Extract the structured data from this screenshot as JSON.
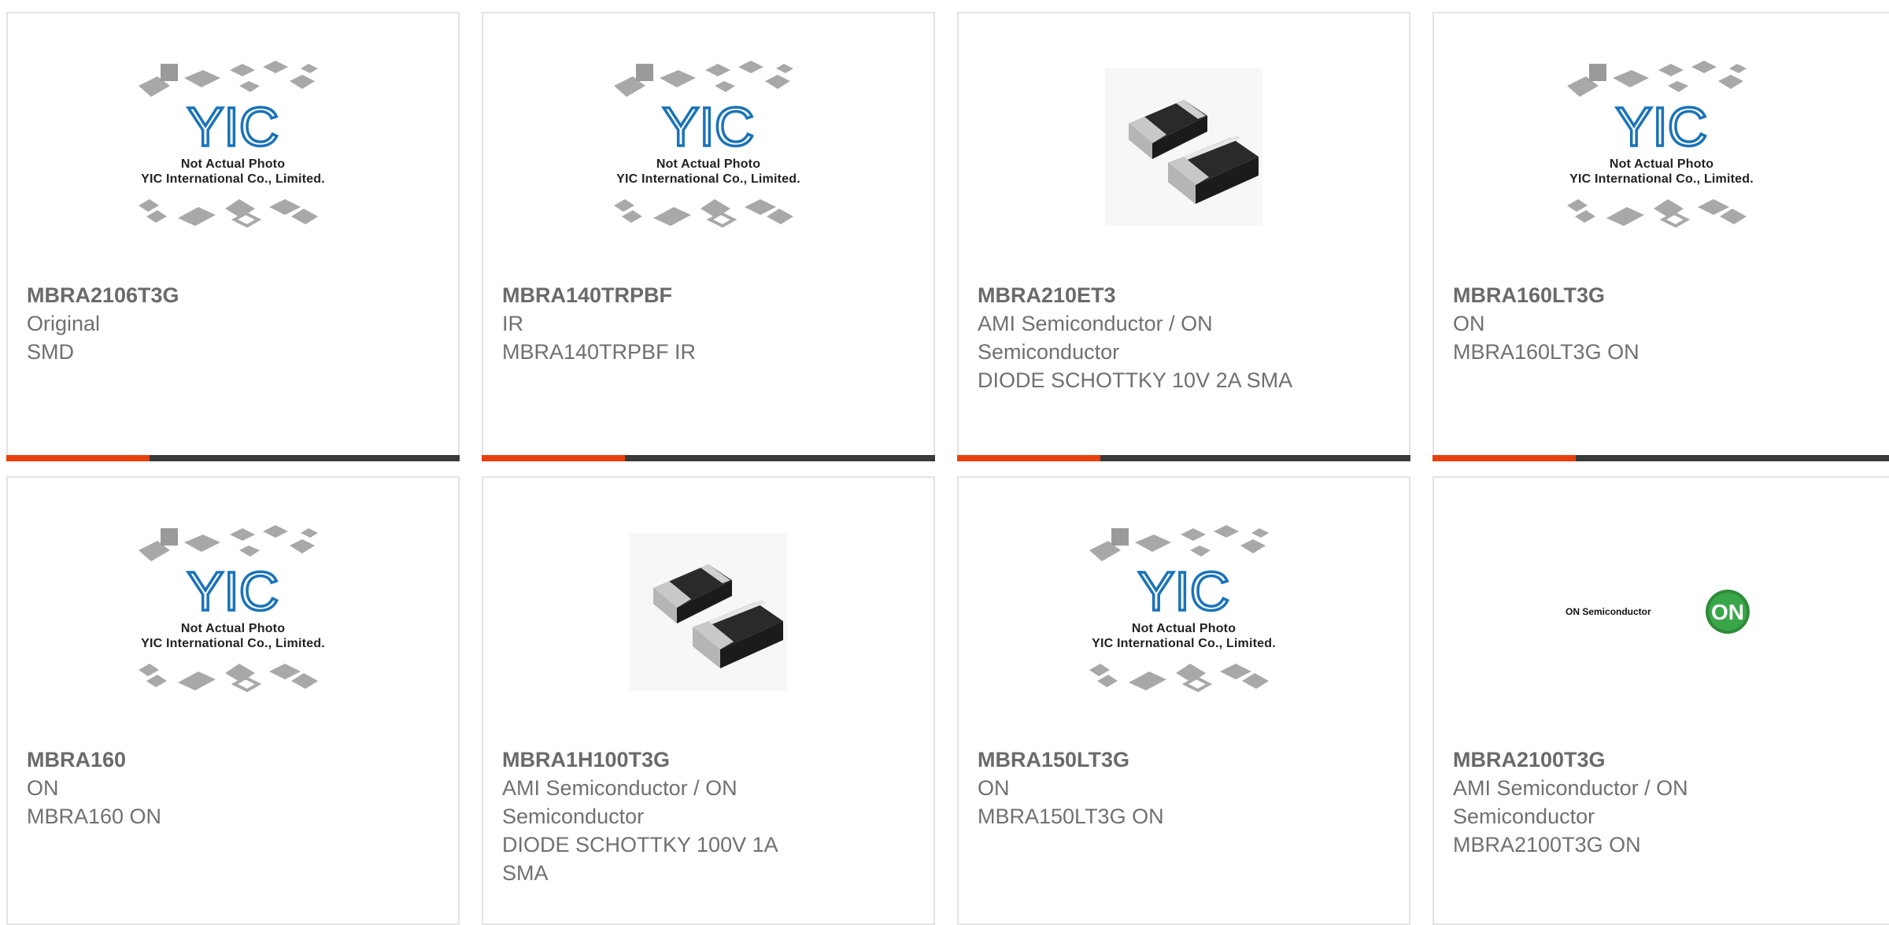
{
  "products": [
    {
      "part_number": "MBRA2106T3G",
      "lines": [
        "Original",
        "SMD"
      ],
      "image": "yic-placeholder"
    },
    {
      "part_number": "MBRA140TRPBF",
      "lines": [
        "IR",
        "MBRA140TRPBF IR"
      ],
      "image": "yic-placeholder"
    },
    {
      "part_number": "MBRA210ET3",
      "lines": [
        "AMI Semiconductor / ON",
        "Semiconductor",
        "DIODE SCHOTTKY 10V 2A SMA"
      ],
      "image": "sma-diode-photo"
    },
    {
      "part_number": "MBRA160LT3G",
      "lines": [
        "ON",
        "MBRA160LT3G ON"
      ],
      "image": "yic-placeholder"
    },
    {
      "part_number": "MBRA160",
      "lines": [
        "ON",
        "MBRA160 ON"
      ],
      "image": "yic-placeholder"
    },
    {
      "part_number": "MBRA1H100T3G",
      "lines": [
        "AMI Semiconductor / ON",
        "Semiconductor",
        "DIODE SCHOTTKY 100V 1A",
        "SMA"
      ],
      "image": "sma-diode-photo"
    },
    {
      "part_number": "MBRA150LT3G",
      "lines": [
        "ON",
        "MBRA150LT3G ON"
      ],
      "image": "yic-placeholder"
    },
    {
      "part_number": "MBRA2100T3G",
      "lines": [
        "AMI Semiconductor / ON",
        "Semiconductor",
        "MBRA2100T3G ON"
      ],
      "image": "on-semiconductor-logo"
    }
  ],
  "placeholder": {
    "logo_text": "YIC",
    "caption_line1": "Not Actual Photo",
    "caption_line2": "YIC International Co., Limited."
  },
  "on_logo": {
    "wordmark": "ON Semiconductor",
    "badge": "ON"
  },
  "colors": {
    "accent": "#e8400c",
    "bar": "#3a3a3a",
    "border": "#e4e4e4",
    "yic_blue": "#1a73b8",
    "on_green": "#2e8b3a"
  }
}
